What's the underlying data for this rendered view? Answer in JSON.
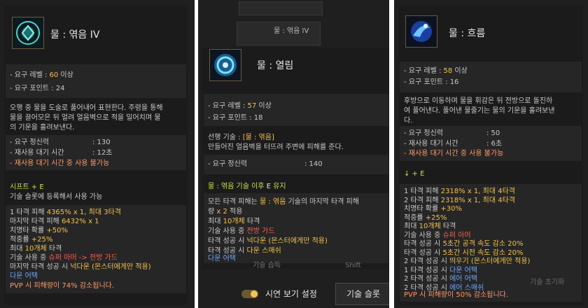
{
  "panel1": {
    "title": "물 : 엮음 IV",
    "req_level_label": "- 요구 레벨 : ",
    "req_level_value": "60",
    "req_level_suffix": " 이상",
    "req_point": "- 요구 포인트 : 24",
    "desc1": "오행 중 물을 도술로 풀어내어 표현한다. 주령을 통해",
    "desc2": "물을 끌어모은 뒤 얼려 얼음벽으로 적을 밀어치며 물",
    "desc3": "의 기운을 흘려보낸다.",
    "spirit_label": "- 요구 정신력",
    "spirit_value": ": 130",
    "cooldown_label": "- 재사용 대기 시간",
    "cooldown_value": ": 12초",
    "cooldown_note": "- 재사용 대기 시간 중 사용 불가능",
    "key": "시프트 + E",
    "key_note": "기술 슬롯에 등록해서 사용 가능",
    "lines": [
      {
        "pre": "1 타격 피해 ",
        "val": "4365% x 1, 최대 3타격",
        "post": ""
      },
      {
        "pre": "마지막 타격 피해 ",
        "val": "6432% x 1",
        "post": ""
      },
      {
        "pre": "치명타 확률 ",
        "val": "+50%",
        "post": ""
      },
      {
        "pre": "적중률 ",
        "val": "+25%",
        "post": ""
      },
      {
        "pre": "최대 ",
        "val": "10개체",
        "post": " 타격"
      },
      {
        "pre": "기술 사용 중 ",
        "val": "슈퍼 아머 -> 전방 가드",
        "post": ""
      },
      {
        "pre": "마지막 타격 성공 시 ",
        "val": "넉다운 (몬스터에게만 적용)",
        "post": ""
      }
    ],
    "down_attack": "다운 어택",
    "pvp": "PVP 시 피해량이 74% 감소됩니다."
  },
  "panel2": {
    "bg_top_label": "물 : 엮음 IV",
    "bg_mid_label": "물 : 엮음",
    "title": "물 : 열림",
    "req_level_label": "- 요구 레벨 : ",
    "req_level_value": "57",
    "req_level_suffix": " 이상",
    "req_point": "- 요구 포인트 : 18",
    "prereq_label": "선행 기술 : ",
    "prereq_value": "[물 : 엮음]",
    "prereq_desc": "만들어진 얼음벽을 터뜨려 주변에 피해를 준다.",
    "spirit_label": "- 요구 정신력",
    "spirit_value": ": 140",
    "cmd_pre": "물 : 엮음 기술 이후 ",
    "cmd_key": "E",
    "cmd_post": " 유지",
    "l1_pre": "모든 타격 피해는 ",
    "l1_val": "물 : 엮음",
    "l1_post": " 기술의 마지막 타격 피해",
    "l2_pre": "량 ",
    "l2_val": "x 2",
    "l2_post": " 적용",
    "l3_pre": "최대 ",
    "l3_val": "10개체",
    "l3_post": " 타격",
    "l4_pre": "기술 사용 중 ",
    "l4_val": "전방 가드",
    "l5_pre": "타격 성공 시 ",
    "l5_val": "넉다운 (몬스터에게만 적용)",
    "l6_pre": "타격 성공 시 ",
    "l6_val": "다운 스매쉬",
    "down_attack": "다운 어택",
    "bg_skill_label": "기술 습득",
    "bg_shift": "Shift",
    "toggle_label": "시연 보기 설정",
    "button_label": "기술 슬롯"
  },
  "panel3": {
    "title": "물 : 흐름",
    "req_level_label": "- 요구 레벨 : ",
    "req_level_value": "58",
    "req_level_suffix": " 이상",
    "req_point": "- 요구 포인트 : 16",
    "desc1": "후방으로 이동하며 물을 휘감은 뒤 전방으로 돌진하",
    "desc2": "여 풀어낸다. 풀어낸 물줄기는 물의 기운을 흘려보낸",
    "desc3": "다.",
    "spirit_label": "- 요구 정신력",
    "spirit_value": ": 50",
    "cooldown_label": "- 재사용 대기 시간",
    "cooldown_value": ": 6초",
    "cooldown_note": "- 재사용 대기 시간 중 사용 불가능",
    "key": "↓ + E",
    "lines": [
      {
        "pre": "1 타격 피해 ",
        "val": "2318% x 1, 최대 4타격",
        "post": ""
      },
      {
        "pre": "2 타격 피해 ",
        "val": "2318% x 1, 최대 4타격",
        "post": ""
      },
      {
        "pre": "치명타 확률 ",
        "val": "+30%",
        "post": ""
      },
      {
        "pre": "적중률 ",
        "val": "+25%",
        "post": ""
      },
      {
        "pre": "최대 ",
        "val": "10개체",
        "post": " 타격"
      }
    ],
    "red_pre": "기술 사용 중 ",
    "red_val": "슈퍼 아머",
    "lines2": [
      {
        "pre": "타격 성공 시 ",
        "val": "5초간 공격 속도 감소 20%",
        "post": ""
      },
      {
        "pre": "타격 성공 시 ",
        "val": "5초간 시전 속도 감소 20%",
        "post": ""
      },
      {
        "pre": "2 타격 성공 시 ",
        "val": "띄우기 (몬스터에게만 적용)",
        "post": ""
      }
    ],
    "blue_lines": [
      {
        "pre": "1 타격 성공 시 ",
        "val": "다운 어택"
      },
      {
        "pre": "2 타격 성공 시 ",
        "val": "에어 어택"
      },
      {
        "pre": "2 타격 성공 시 ",
        "val": "에어 스매쉬"
      }
    ],
    "pvp": "PVP 시 피해량이 50% 감소됩니다.",
    "bg_right_label": "기술 초기화"
  },
  "colors": {
    "accent_yellow": "#f0c24a",
    "accent_red": "#ff5f4a",
    "accent_green": "#c7e14f",
    "accent_blue": "#6fa6ff"
  }
}
